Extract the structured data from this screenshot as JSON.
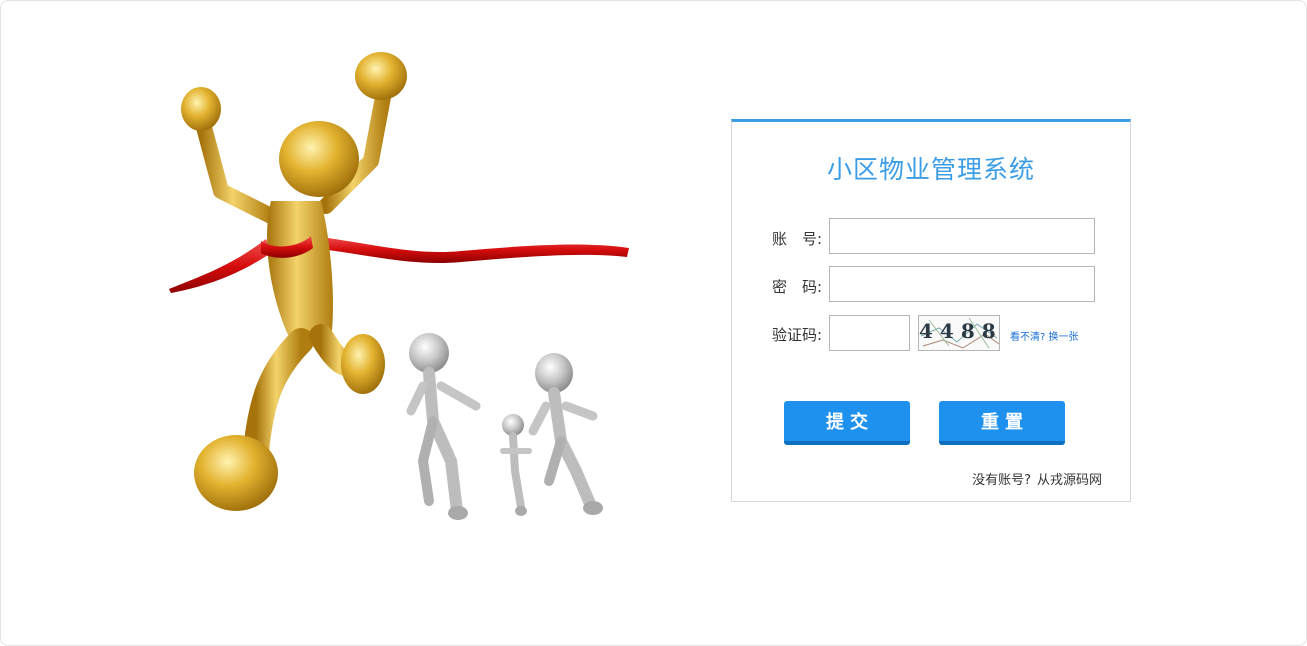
{
  "login": {
    "title": "小区物业管理系统",
    "username_label": "账　号:",
    "username_value": "",
    "password_label": "密　码:",
    "password_value": "",
    "captcha_label": "验证码:",
    "captcha_value": "",
    "captcha_image_text": "4488",
    "refresh_link": "看不清? 换一张",
    "submit_button": "提交",
    "reset_button": "重置",
    "register_prompt": "没有账号?",
    "register_link": "从戎源码网"
  },
  "colors": {
    "accent": "#3b9de6",
    "button": "#1e90ee",
    "gold_figure": "#d9a21a",
    "silver_figure": "#b8b8b8",
    "ribbon": "#e01818"
  },
  "illustration": {
    "description_icon": "winner-crossing-finish-line-illustration"
  }
}
